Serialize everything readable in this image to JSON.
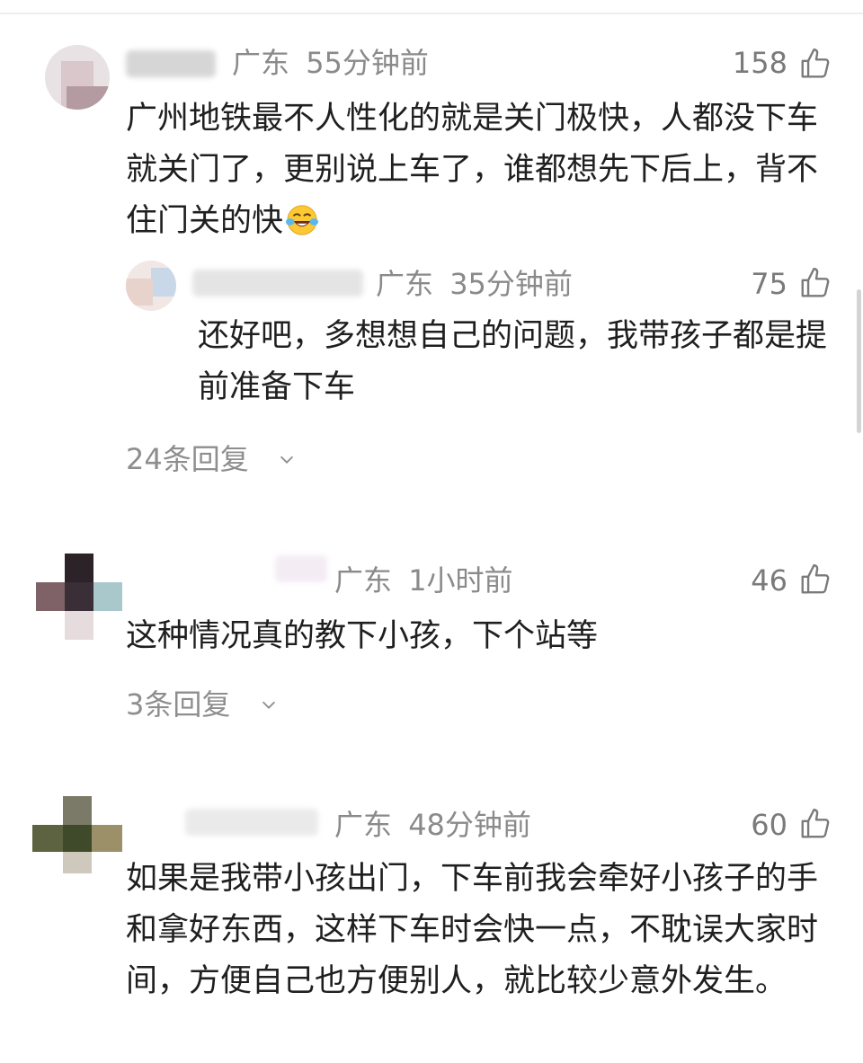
{
  "colors": {
    "meta_gray": "#8a8a8a",
    "text": "#1f1f1f",
    "background": "#ffffff"
  },
  "icons": {
    "like": "thumbs-up-icon",
    "expand": "chevron-down-icon",
    "emoji": "laughing-tears-emoji-icon"
  },
  "comments": [
    {
      "location": "广东",
      "time": "55分钟前",
      "likes": "158",
      "text": "广州地铁最不人性化的就是关门极快，人都没下车就关门了，更别说上车了，谁都想先下后上，背不住门关的快",
      "reply": {
        "location": "广东",
        "time": "35分钟前",
        "likes": "75",
        "text": "还好吧，多想想自己的问题，我带孩子都是提前准备下车"
      },
      "replies_label": "24条回复"
    },
    {
      "location": "广东",
      "time": "1小时前",
      "likes": "46",
      "text": "这种情况真的教下小孩，下个站等",
      "replies_label": "3条回复"
    },
    {
      "location": "广东",
      "time": "48分钟前",
      "likes": "60",
      "text": "如果是我带小孩出门，下车前我会牵好小孩子的手和拿好东西，这样下车时会快一点，不耽误大家时间，方便自己也方便别人，就比较少意外发生。"
    }
  ]
}
